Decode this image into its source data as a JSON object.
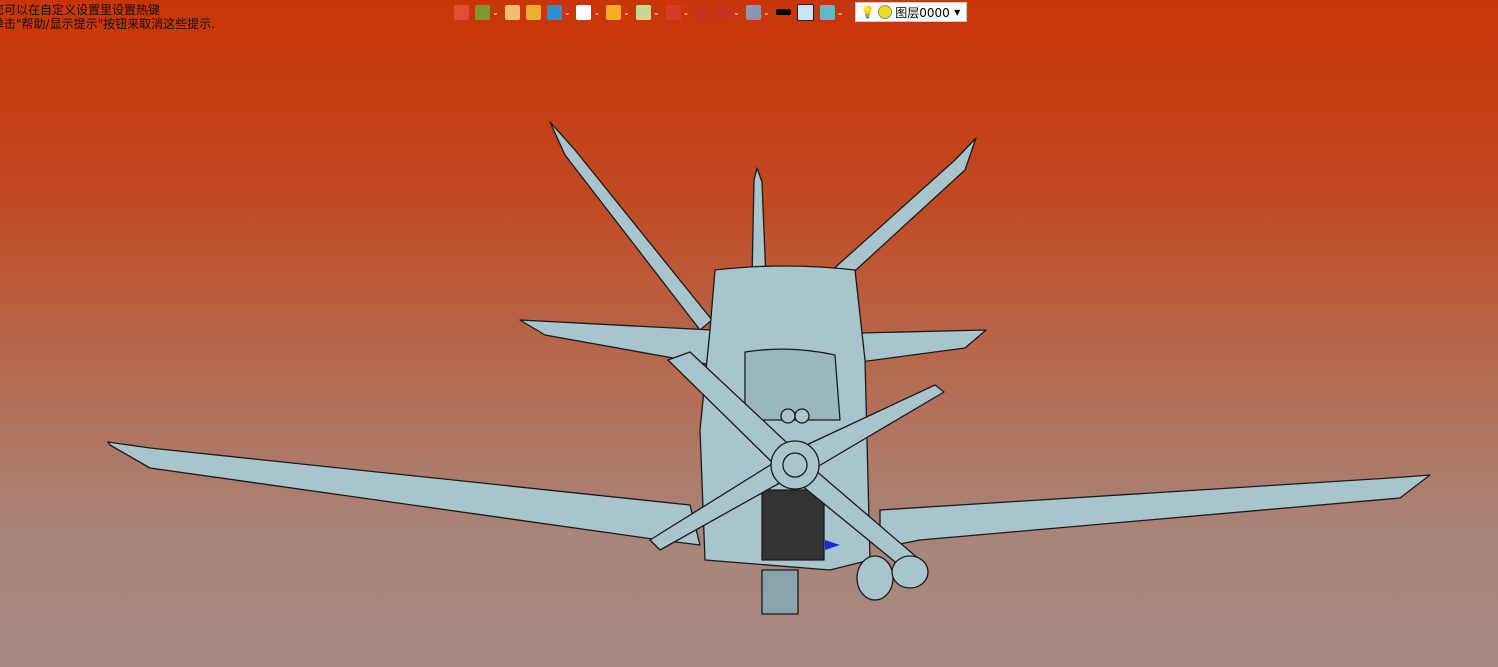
{
  "hints": {
    "line1": "您可以在自定义设置里设置热键",
    "line2": "单击\"帮助/显示提示\"按钮来取消这些提示."
  },
  "toolbar": {
    "items": [
      {
        "icon": "exit-icon",
        "color": "#e05030",
        "dropdown": false
      },
      {
        "icon": "assembly-icon",
        "color": "#7a9a30",
        "dropdown": true
      },
      {
        "icon": "pen-icon",
        "color": "#f0c070",
        "dropdown": false
      },
      {
        "icon": "shaded-box-icon",
        "color": "#e8b030",
        "dropdown": false
      },
      {
        "icon": "blue-cube-icon",
        "color": "#2a90d8",
        "dropdown": true
      },
      {
        "icon": "white-cube-icon",
        "color": "#ffffff",
        "dropdown": true
      },
      {
        "icon": "section-icon",
        "color": "#f4b020",
        "dropdown": true
      },
      {
        "icon": "zoom-icon",
        "color": "#c8d890",
        "dropdown": true
      },
      {
        "icon": "pan-icon",
        "color": "#d83a2a",
        "dropdown": true
      },
      {
        "icon": "snap-icon",
        "color": "#c83020",
        "dropdown": false
      },
      {
        "icon": "ruler-icon",
        "color": "#c83020",
        "dropdown": true
      },
      {
        "icon": "display-icon",
        "color": "#8898b0",
        "dropdown": true
      },
      {
        "icon": "line-color-icon",
        "color": "#000000",
        "dropdown": false
      },
      {
        "icon": "fill-color-icon",
        "color": "#c8e4f8",
        "dropdown": false
      },
      {
        "icon": "layers-stack-icon",
        "color": "#60b8c8",
        "dropdown": true
      }
    ],
    "layer": {
      "label": "图层0000",
      "bulb_icon": "lightbulb-icon",
      "dot_color": "#e8e020"
    }
  },
  "colors": {
    "model": "#a8c4cc",
    "edge": "#1a1a1a"
  }
}
